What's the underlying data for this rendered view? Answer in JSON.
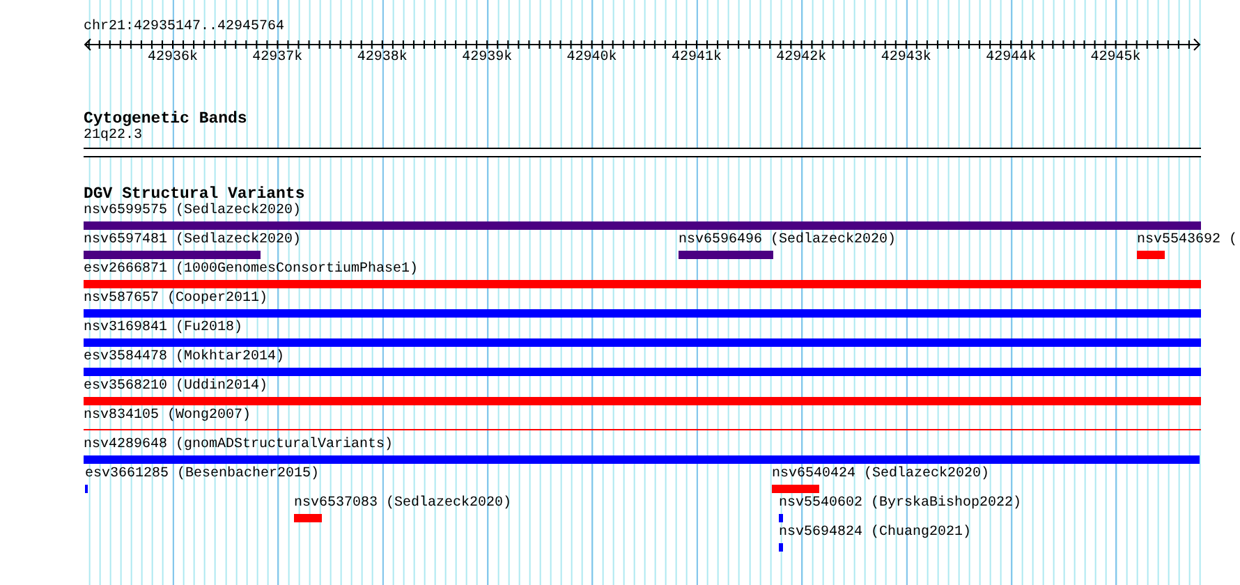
{
  "ruler": {
    "title": "chr21:42935147..42945764",
    "tick_labels": [
      "42936k",
      "42937k",
      "42938k",
      "42939k",
      "42940k",
      "42941k",
      "42942k",
      "42943k",
      "42944k",
      "42945k"
    ]
  },
  "cytogenetic_bands": {
    "title": "Cytogenetic Bands",
    "band_label": "21q22.3"
  },
  "dgv_track": {
    "title": "DGV Structural Variants",
    "lanes": [
      {
        "features": [
          {
            "label": "nsv6599575 (Sedlazeck2020)",
            "color": "#4b0082",
            "kind": "bar"
          }
        ]
      },
      {
        "features": [
          {
            "label": "nsv6597481 (Sedlazeck2020)",
            "color": "#4b0082",
            "kind": "bar"
          },
          {
            "label": "nsv6596496 (Sedlazeck2020)",
            "color": "#4b0082",
            "kind": "bar"
          },
          {
            "label": "nsv5543692 (",
            "color": "#ff0000",
            "kind": "bar"
          }
        ]
      },
      {
        "features": [
          {
            "label": "esv2666871 (1000GenomesConsortiumPhase1)",
            "color": "#ff0000",
            "kind": "bar"
          }
        ]
      },
      {
        "features": [
          {
            "label": "nsv587657 (Cooper2011)",
            "color": "#0000ff",
            "kind": "bar"
          }
        ]
      },
      {
        "features": [
          {
            "label": "nsv3169841 (Fu2018)",
            "color": "#0000ff",
            "kind": "bar"
          }
        ]
      },
      {
        "features": [
          {
            "label": "esv3584478 (Mokhtar2014)",
            "color": "#0000ff",
            "kind": "bar"
          }
        ]
      },
      {
        "features": [
          {
            "label": "esv3568210 (Uddin2014)",
            "color": "#ff0000",
            "kind": "bar"
          }
        ]
      },
      {
        "features": [
          {
            "label": "nsv834105 (Wong2007)",
            "color": "#ff0000",
            "kind": "line"
          }
        ]
      },
      {
        "features": [
          {
            "label": "nsv4289648 (gnomADStructuralVariants)",
            "color": "#0000ff",
            "kind": "bar"
          }
        ]
      },
      {
        "features": [
          {
            "label": "esv3661285 (Besenbacher2015)",
            "color": "#0000ff",
            "kind": "bar"
          },
          {
            "label": "nsv6540424 (Sedlazeck2020)",
            "color": "#ff0000",
            "kind": "bar"
          }
        ]
      },
      {
        "features": [
          {
            "label": "nsv6537083 (Sedlazeck2020)",
            "color": "#ff0000",
            "kind": "bar"
          },
          {
            "label": "nsv5540602 (ByrskaBishop2022)",
            "color": "#0000ff",
            "kind": "bar"
          }
        ]
      },
      {
        "features": [
          {
            "label": "nsv5694824 (Chuang2021)",
            "color": "#0000ff",
            "kind": "bar"
          }
        ]
      }
    ]
  }
}
